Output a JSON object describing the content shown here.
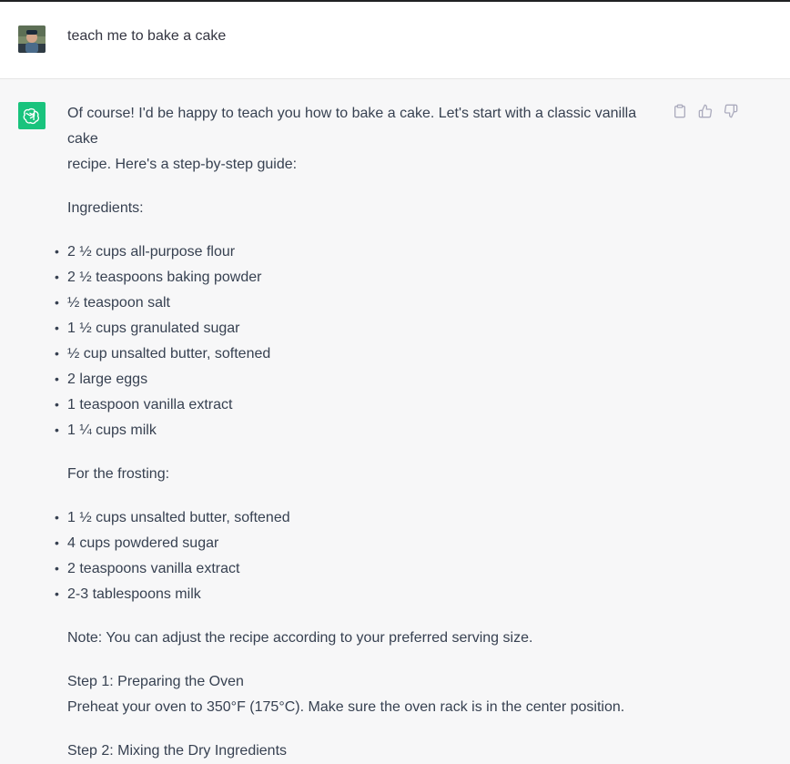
{
  "user": {
    "message": "teach me to bake a cake"
  },
  "assistant": {
    "intro_1": "Of course! I'd be happy to teach you how to bake a cake. Let's start with a classic vanilla cake",
    "intro_2": "recipe. Here's a step-by-step guide:",
    "ingredients_heading": "Ingredients:",
    "ingredients": [
      "2 ½ cups all-purpose flour",
      "2 ½ teaspoons baking powder",
      "½ teaspoon salt",
      "1 ½ cups granulated sugar",
      "½ cup unsalted butter, softened",
      "2 large eggs",
      "1 teaspoon vanilla extract",
      "1 ¼ cups milk"
    ],
    "frosting_heading": "For the frosting:",
    "frosting": [
      "1 ½ cups unsalted butter, softened",
      "4 cups powdered sugar",
      "2 teaspoons vanilla extract",
      "2-3 tablespoons milk"
    ],
    "note": "Note: You can adjust the recipe according to your preferred serving size.",
    "step1_title": "Step 1: Preparing the Oven",
    "step1_text": "Preheat your oven to 350°F (175°C). Make sure the oven rack is in the center position.",
    "step2_title": "Step 2: Mixing the Dry Ingredients"
  },
  "icons": {
    "copy": "clipboard-icon",
    "like": "thumbs-up-icon",
    "dislike": "thumbs-down-icon",
    "assistant_logo": "openai-logo-icon"
  },
  "colors": {
    "accent": "#19c37d",
    "user_bg": "#ffffff",
    "assistant_bg": "#f7f7f8",
    "text": "#374151"
  }
}
